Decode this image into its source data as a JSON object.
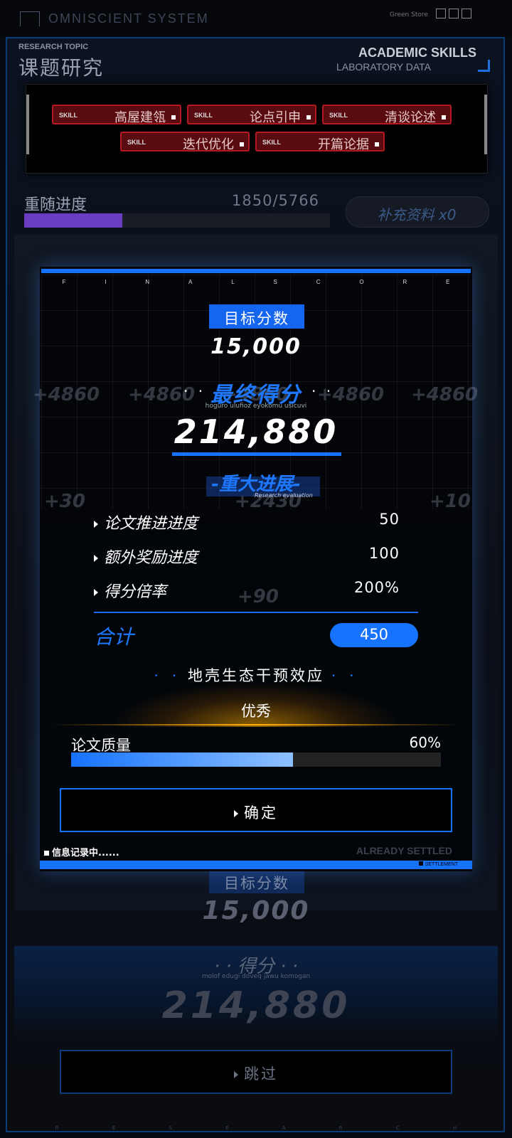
{
  "system": {
    "title": "OMNISCIENT SYSTEM",
    "status_small": "Green Store"
  },
  "header": {
    "topic_en": "RESEARCH TOPIC",
    "topic_cn": "课题研究",
    "skills_en": "ACADEMIC SKILLS",
    "lab_en": "LABORATORY DATA"
  },
  "skills": [
    {
      "tag": "SKILL",
      "name": "高屋建瓴"
    },
    {
      "tag": "SKILL",
      "name": "论点引申"
    },
    {
      "tag": "SKILL",
      "name": "清谈论述"
    },
    {
      "tag": "SKILL",
      "name": "迭代优化"
    },
    {
      "tag": "SKILL",
      "name": "开篇论据"
    }
  ],
  "follow": {
    "label": "重随进度",
    "value": "1850/5766",
    "progress": 0.32
  },
  "supplement_button": "补充资料 x0",
  "modal": {
    "banner_letters": [
      "F",
      "I",
      "N",
      "A",
      "L",
      "S",
      "C",
      "O",
      "R",
      "E"
    ],
    "target_label": "目标分数",
    "target_value": "15,000",
    "final_label": "最终得分",
    "final_dots": "· ·",
    "final_subtitle": "hoguro ulufioz eyokomu usicuvi",
    "final_value": "214,880",
    "progress_label": "-重大进展-",
    "progress_subtitle": "Research evaluation",
    "ghost_numbers": [
      "+4860",
      "+4860",
      "+4860",
      "+4860",
      "+4860",
      "+30",
      "+2430",
      "+10",
      "+90"
    ],
    "rows": [
      {
        "label": "论文推进进度",
        "value": "50"
      },
      {
        "label": "额外奖励进度",
        "value": "100"
      },
      {
        "label": "得分倍率",
        "value": "200%"
      }
    ],
    "total_label": "合计",
    "total_value": "450",
    "eco_label": "地壳生态干预效应",
    "eco_dots": "· ·",
    "grade": "优秀",
    "quality_label": "论文质量",
    "quality_value": "60%",
    "quality_progress": 0.6,
    "confirm_button": "确定",
    "recording": "信息记录中......",
    "settled_ghost": "ALREADY SETTLED",
    "settlement_tag": "SETTLEMENT"
  },
  "background": {
    "target_label": "目标分数",
    "target_value": "15,000",
    "score_label": "· · 得分 · ·",
    "score_subtitle": "molof edugi doveq jawu komogan",
    "score_value": "214,880",
    "skip_button": "跳过",
    "bottom_letters": [
      "R",
      "E",
      "S",
      "E",
      "A",
      "R",
      "C",
      "H"
    ]
  },
  "colors": {
    "accent": "#1673ff",
    "skill_red": "#b41822",
    "follow_purple": "#6a3cc2",
    "grade_glow": "#ffb000"
  }
}
